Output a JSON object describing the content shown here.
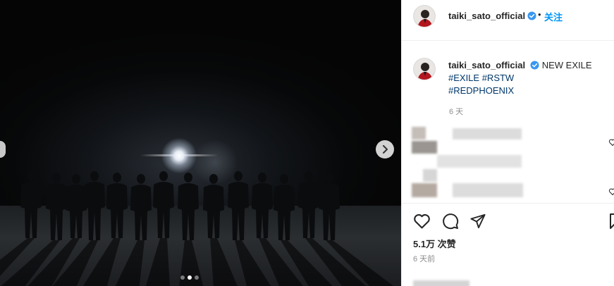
{
  "post": {
    "username": "taiki_sato_official",
    "follow_label": "关注",
    "separator": "•",
    "caption_text": "NEW EXILE",
    "hashtags_line1": "#EXILE #RSTW",
    "hashtags_line2": "#REDPHOENIX",
    "caption_age": "6 天",
    "likes_label": "5.1万 次赞",
    "posted_age": "6 天前"
  },
  "carousel": {
    "slide_count": 3,
    "active_slide": 2
  },
  "colors": {
    "accent": "#0095f6",
    "verified": "#3897f0",
    "hashtag": "#00376b",
    "muted": "#8e8e8e"
  },
  "icons": {
    "verified": "verified-badge-icon",
    "next": "chevron-right-icon",
    "like": "heart-icon",
    "comment": "comment-bubble-icon",
    "share": "paper-plane-icon",
    "save": "bookmark-icon"
  }
}
